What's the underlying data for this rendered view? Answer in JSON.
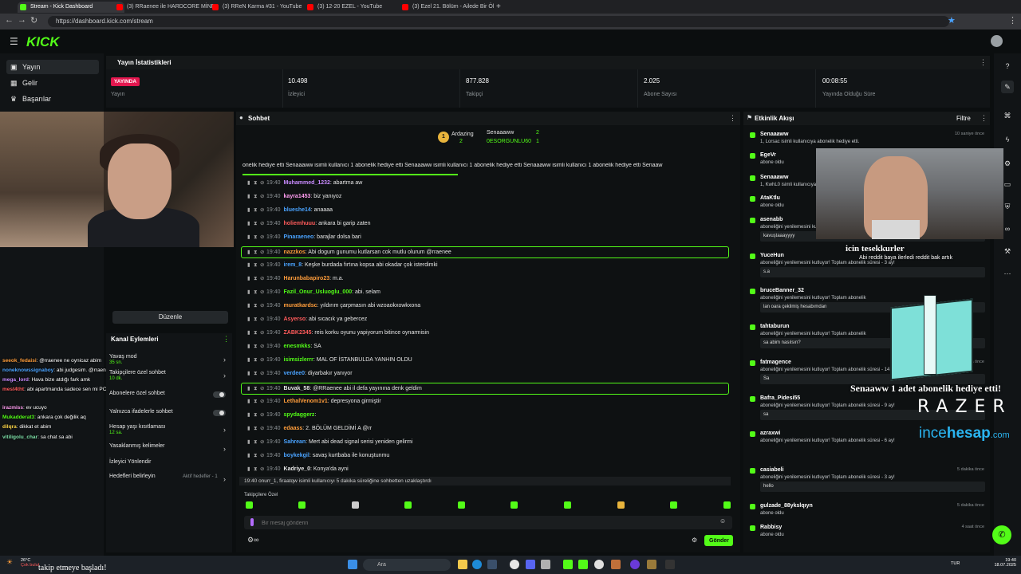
{
  "browser": {
    "tabs": [
      {
        "title": "Stream - Kick Dashboard",
        "color": "#53fc18"
      },
      {
        "title": "(3) RRaenee ile HARDCORE MİNE",
        "color": "#ff0000"
      },
      {
        "title": "(3) RReN Karma #31 - YouTube",
        "color": "#ff0000"
      },
      {
        "title": "(3) 12-20 EZEL - YouTube",
        "color": "#ff0000"
      },
      {
        "title": "(3) Ezel 21. Bölüm - Ailede Bir Öl",
        "color": "#ff0000"
      }
    ],
    "url": "https://dashboard.kick.com/stream"
  },
  "header": {
    "logo": "KICK"
  },
  "sidebar": {
    "items": [
      {
        "label": "Yayın"
      },
      {
        "label": "Gelir"
      },
      {
        "label": "Başarılar"
      }
    ]
  },
  "stats": {
    "title": "Yayın İstatistikleri",
    "live_badge": "YAYINDA",
    "live_label": "Yayın",
    "cells": [
      {
        "value": "10.498",
        "label": "İzleyici"
      },
      {
        "value": "877.828",
        "label": "Takipçi"
      },
      {
        "value": "2.025",
        "label": "Abone Sayısı"
      },
      {
        "value": "00:08:55",
        "label": "Yayında Olduğu Süre"
      }
    ]
  },
  "edit_button": "Düzenle",
  "overlay_chat": [
    {
      "user": "seeok_fedaisi",
      "text": ": @rraenee ne oynicaz abim",
      "color": "#ff9d3b"
    },
    {
      "user": "noneknowssignaboy",
      "text": ": abi judgesim. @rraenee",
      "color": "#4aa3ff"
    },
    {
      "user": "mega_lord",
      "text": ": Hava bize atdığı fark amk",
      "color": "#c98bff"
    },
    {
      "user": "mest4tht",
      "text": ": abi apartmanda sadece sen mi PC kullanıyon yoksa varmı kullanan ona göre gitmiştir",
      "color": "#ff5b5b"
    },
    {
      "user": "irazmiss",
      "text": ": ev ucuyo",
      "color": "#ff9df0"
    },
    {
      "user": "Mukadderat3",
      "text": ": ankara çok değilik aq",
      "color": "#53fc18"
    },
    {
      "user": "dilqra",
      "text": ": dikkat et abim",
      "color": "#ffd84a"
    },
    {
      "user": "vitiligolu_char",
      "text": ": sa chat sa abi",
      "color": "#7ee0a8"
    }
  ],
  "channel_actions": {
    "title": "Kanal Eylemleri",
    "items": [
      {
        "label": "Yavaş mod",
        "sub": "35 sn.",
        "control": "arrow"
      },
      {
        "label": "Takipçilere özel sohbet",
        "sub": "10 dk.",
        "control": "arrow"
      },
      {
        "label": "Abonelere özel sohbet",
        "sub": "",
        "control": "toggle"
      },
      {
        "label": "Yalnızca ifadelerle sohbet",
        "sub": "",
        "control": "toggle"
      },
      {
        "label": "Hesap yaşı kısıtlaması",
        "sub": "12 sa.",
        "control": "arrow"
      },
      {
        "label": "Yasaklanmış kelimeler",
        "sub": "",
        "control": "arrow"
      },
      {
        "label": "İzleyici Yönlendir",
        "sub": "",
        "control": "none"
      },
      {
        "label": "Hedefleri belirleyin",
        "sub": "Aktif hedefler - 1",
        "control": "arrow"
      }
    ]
  },
  "chat": {
    "title": "Sohbet",
    "leaders": [
      {
        "name": "Ardazing",
        "count": "2"
      },
      {
        "name": "Senaaaww",
        "count": "2"
      },
      {
        "name": "0ESORGUNLU60",
        "count": "1"
      }
    ],
    "ticker": "onelik hediye etti  Senaaaww isimli kullanıcı 1 abonelik hediye etti  Senaaaww isimli kullanıcı 1 abonelik hediye etti  Senaaaww isimli kullanıcı 1 abonelik hediye etti  Senaaw",
    "messages": [
      {
        "time": "19:40",
        "user": "Muhammed_1232",
        "text": ": abartma aw",
        "color": "#c98bff",
        "hl": false
      },
      {
        "time": "19:40",
        "user": "kayra1453",
        "text": ": biz yanıyoz",
        "color": "#ff9df0",
        "hl": false
      },
      {
        "time": "19:40",
        "user": "blueshe14",
        "text": ": anaaaa",
        "color": "#4aa3ff",
        "hl": false
      },
      {
        "time": "19:40",
        "user": "holiemhuuu",
        "text": ": ankara bi garip zaten",
        "color": "#ff5b5b",
        "hl": false
      },
      {
        "time": "19:40",
        "user": "Pinaraeneo",
        "text": ": barajlar dolsa bari",
        "color": "#4aa3ff",
        "hl": false
      },
      {
        "time": "19:40",
        "user": "nazzkos",
        "text": ": Abi dogum gunumu kutlarsan cok mutlu olurum @rraenee",
        "color": "#ff9d3b",
        "hl": true
      },
      {
        "time": "19:40",
        "user": "irem_8",
        "text": ": Keşke burdada fırtına kopsa abi okadar çok isterdimki",
        "color": "#4aa3ff",
        "hl": false
      },
      {
        "time": "19:40",
        "user": "Harunbabapiro23",
        "text": ": m.a.",
        "color": "#ff9d3b",
        "hl": false
      },
      {
        "time": "19:40",
        "user": "Fazil_Onur_Usluoglu_000",
        "text": ": abi. selam",
        "color": "#53fc18",
        "hl": false
      },
      {
        "time": "19:40",
        "user": "muratkardsc",
        "text": ": yıldırım çarpmasın abi wzoaokxowkxona",
        "color": "#ff9d3b",
        "hl": false
      },
      {
        "time": "19:40",
        "user": "Asyerso",
        "text": ": abi sıcacık ya gebercez",
        "color": "#ff5b5b",
        "hl": false
      },
      {
        "time": "19:40",
        "user": "ZABK2345",
        "text": ": reis korku oyunu yapiyorum bitince oynarmisin",
        "color": "#ff5b5b",
        "hl": false
      },
      {
        "time": "19:40",
        "user": "enesmkks",
        "text": ": SA",
        "color": "#53fc18",
        "hl": false
      },
      {
        "time": "19:40",
        "user": "isimsizlerrr",
        "text": ": MAL OF İSTANBULDA YANHIN OLDU",
        "color": "#53fc18",
        "hl": false
      },
      {
        "time": "19:40",
        "user": "verdee0",
        "text": ": diyarbakır yanıyor",
        "color": "#4aa3ff",
        "hl": false
      },
      {
        "time": "19:40",
        "user": "Buvak_58",
        "text": ": @RRaenee abi il defa yayınına denk geldim",
        "color": "#e6e6e6",
        "hl": true
      },
      {
        "time": "19:40",
        "user": "LethalVenom1v1",
        "text": ": depresyona girmiştir",
        "color": "#ff9d3b",
        "hl": false
      },
      {
        "time": "19:40",
        "user": "spydaggerz",
        "text": ":",
        "color": "#53fc18",
        "hl": false
      },
      {
        "time": "19:40",
        "user": "edaass",
        "text": ": 2. BÖLÜM GELDİMİ A @rr",
        "color": "#ff9d3b",
        "hl": false
      },
      {
        "time": "19:40",
        "user": "Sahrean",
        "text": ": Mert abi dead signal serisi yeniden gelirmi",
        "color": "#4aa3ff",
        "hl": false
      },
      {
        "time": "19:40",
        "user": "boykekgil",
        "text": ": savaş kurtbaba ile konuştunmu",
        "color": "#4aa3ff",
        "hl": false
      },
      {
        "time": "19:40",
        "user": "Kadriye_0",
        "text": ": Konya'da ayni",
        "color": "#e6e6e6",
        "hl": false
      }
    ],
    "system_message": "19:40  onurr_1, firaatqw isimli kullanıcıyı 5 dakika süreliğine sohbetten uzaklaştırdı",
    "emote_label": "Takipçilere Özel",
    "input_placeholder": "Bir mesaj gönderin",
    "send_label": "Gönder"
  },
  "activity": {
    "title": "Etkinlik Akışı",
    "filter_label": "Filtre",
    "events": [
      {
        "name": "Senaaaww",
        "sub": "1, Lorsac isimli kullanıcıya abonelik hediye etti.",
        "time": "10 saniye önce",
        "msg": ""
      },
      {
        "name": "EgeVr",
        "sub": "abone oldu",
        "time": "",
        "msg": ""
      },
      {
        "name": "Senaaaww",
        "sub": "1, KwhL0 isimli kullanıcıya abonelik hediye etti.",
        "time": "",
        "msg": ""
      },
      {
        "name": "AtaKtlu",
        "sub": "abone oldu",
        "time": "",
        "msg": ""
      },
      {
        "name": "asenabb",
        "sub": "aboneliğini yenilemesini kutluyor!",
        "time": "",
        "msg": "kavuştaaayyyy"
      },
      {
        "name": "YuceHun",
        "sub": "aboneliğini yenilemesini kutluyor! Toplam abonelik süresi - 3 ay!",
        "time": "",
        "msg": "s.a"
      },
      {
        "name": "bruceBanner_32",
        "sub": "aboneliğini yenilemesini kutluyor! Toplam abonelik",
        "time": "",
        "msg": "lan oara çekilmiş hesabımdan"
      },
      {
        "name": "tahtaburun",
        "sub": "aboneliğini yenilemesini kutluyor! Toplam abonelik",
        "time": "",
        "msg": "sa abim nasılsın?"
      },
      {
        "name": "fatmagence",
        "sub": "aboneliğini yenilemesini kutluyor! Toplam abonelik süresi - 14 ay!",
        "time": "3 dakika önce",
        "msg": "Sa"
      },
      {
        "name": "Bafra_Pidesi55",
        "sub": "aboneliğini yenilemesini kutluyor! Toplam abonelik süresi - 9 ay!",
        "time": "",
        "msg": "sa"
      },
      {
        "name": "azraxwi",
        "sub": "aboneliğini yenilemesini kutluyor! Toplam abonelik süresi - 6 ay!",
        "time": "",
        "msg": ""
      },
      {
        "name": "casiabeli",
        "sub": "aboneliğini yenilemesini kutluyor! Toplam abonelik süresi - 3 ay!",
        "time": "5 dakika önce",
        "msg": "hello"
      },
      {
        "name": "gulzade_88ykslqıyn",
        "sub": "abone oldu",
        "time": "5 dakika önce",
        "msg": ""
      },
      {
        "name": "Rabbisy",
        "sub": "abone oldu",
        "time": "4 saat önce",
        "msg": ""
      }
    ]
  },
  "overlay": {
    "thanks": "icin tesekkurler",
    "reddit_note": "Abi reddit baya ilerledi reddit bak artık",
    "gift_text": "Senaaww 1 adet abonelik hediye etti!",
    "brand1": "RAZER",
    "brand2_a": "ince",
    "brand2_b": "hesap",
    "brand2_c": ".com"
  },
  "taskbar": {
    "temp": "26°C",
    "weather": "Çok bulut",
    "follow_note": "takip etmeye başladı!",
    "search": "Ara",
    "lang": "TUR",
    "time": "19:40",
    "date": "18.07.2025"
  }
}
